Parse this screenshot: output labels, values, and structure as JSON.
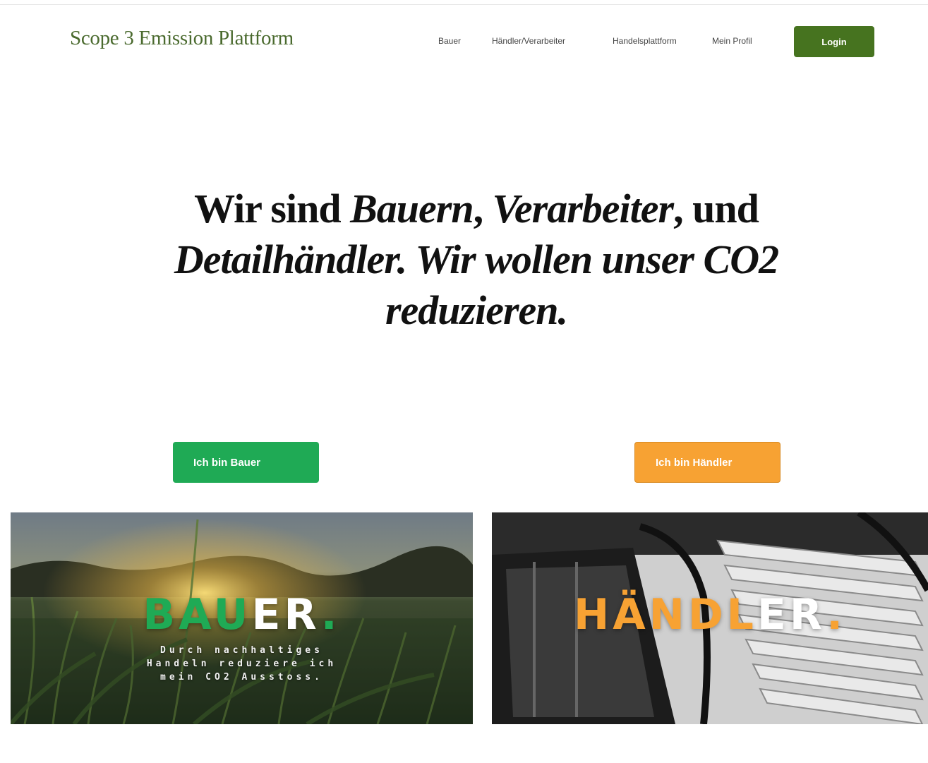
{
  "header": {
    "brand": "Scope 3 Emission Plattform",
    "nav": [
      "Bauer",
      "Händler/Verarbeiter",
      "Handelsplattform",
      "Mein Profil"
    ],
    "login_label": "Login"
  },
  "hero": {
    "line1_a": "Wir sind ",
    "line1_b": "Bauern",
    "line1_c": ", ",
    "line1_d": "Verarbeiter",
    "line1_e": ", und",
    "line2": "Detailhändler. Wir wollen unser CO2",
    "line3": "reduzieren."
  },
  "buttons": {
    "farmer": "Ich bin Bauer",
    "trader": "Ich bin Händler"
  },
  "cards": {
    "farmer": {
      "title_a": "BAU",
      "title_b": "ER",
      "title_c": ".",
      "text": [
        "Durch nachhaltiges",
        "Handeln reduziere ich",
        "mein CO2 Ausstoss."
      ]
    },
    "trader": {
      "title_a": "HÄNDL",
      "title_b": "ER",
      "title_c": "."
    }
  },
  "colors": {
    "brand_green": "#4a6a2e",
    "login_green": "#46731f",
    "farmer_green": "#1faa55",
    "trader_orange": "#f7a233"
  }
}
